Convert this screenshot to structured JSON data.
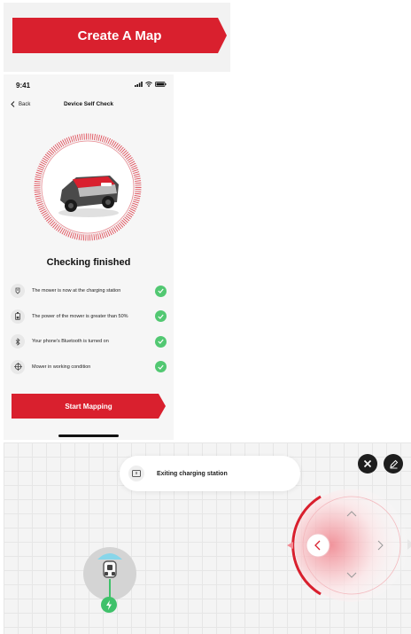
{
  "banner": {
    "create_map_label": "Create A Map"
  },
  "status_bar": {
    "time": "9:41"
  },
  "nav": {
    "back_label": "Back",
    "title": "Device Self Check"
  },
  "self_check": {
    "result_title": "Checking finished",
    "items": [
      {
        "label": "The mower is now at the charging station",
        "icon": "station-icon",
        "status": "passed"
      },
      {
        "label": "The power of the mower is greater than 50%",
        "icon": "battery-icon",
        "status": "passed"
      },
      {
        "label": "Your phone's Bluetooth is turned on",
        "icon": "bluetooth-icon",
        "status": "passed"
      },
      {
        "label": "Mower in working condition",
        "icon": "joystick-icon",
        "status": "passed"
      }
    ],
    "start_label": "Start Mapping"
  },
  "map": {
    "toast_text": "Exiting charging station"
  },
  "colors": {
    "brand_red": "#d9202e",
    "success_green": "#52c872",
    "dark_button": "#1e1e1e"
  }
}
